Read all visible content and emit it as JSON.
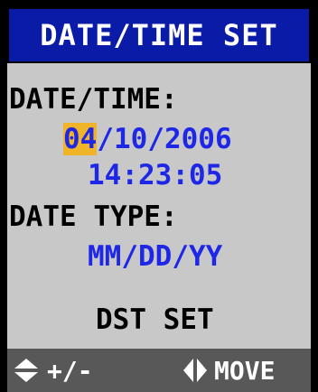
{
  "title": "DATE/TIME SET",
  "datetime": {
    "label": "DATE/TIME:",
    "date_selected": "04",
    "date_rest": "/10/2006",
    "time": "14:23:05"
  },
  "date_type": {
    "label": "DATE TYPE:",
    "value": "MM/DD/YY"
  },
  "dst_label": "DST SET",
  "status_bar": {
    "adjust_icon": "up-down-arrow-icon",
    "adjust_label": "+/-",
    "move_icon": "left-right-arrow-icon",
    "move_label": "MOVE"
  },
  "colors": {
    "title_bg": "#0A1BA8",
    "content_bg": "#C8C8C8",
    "value_text": "#1E27E6",
    "highlight": "#F0B428",
    "status_bg": "#585858"
  }
}
